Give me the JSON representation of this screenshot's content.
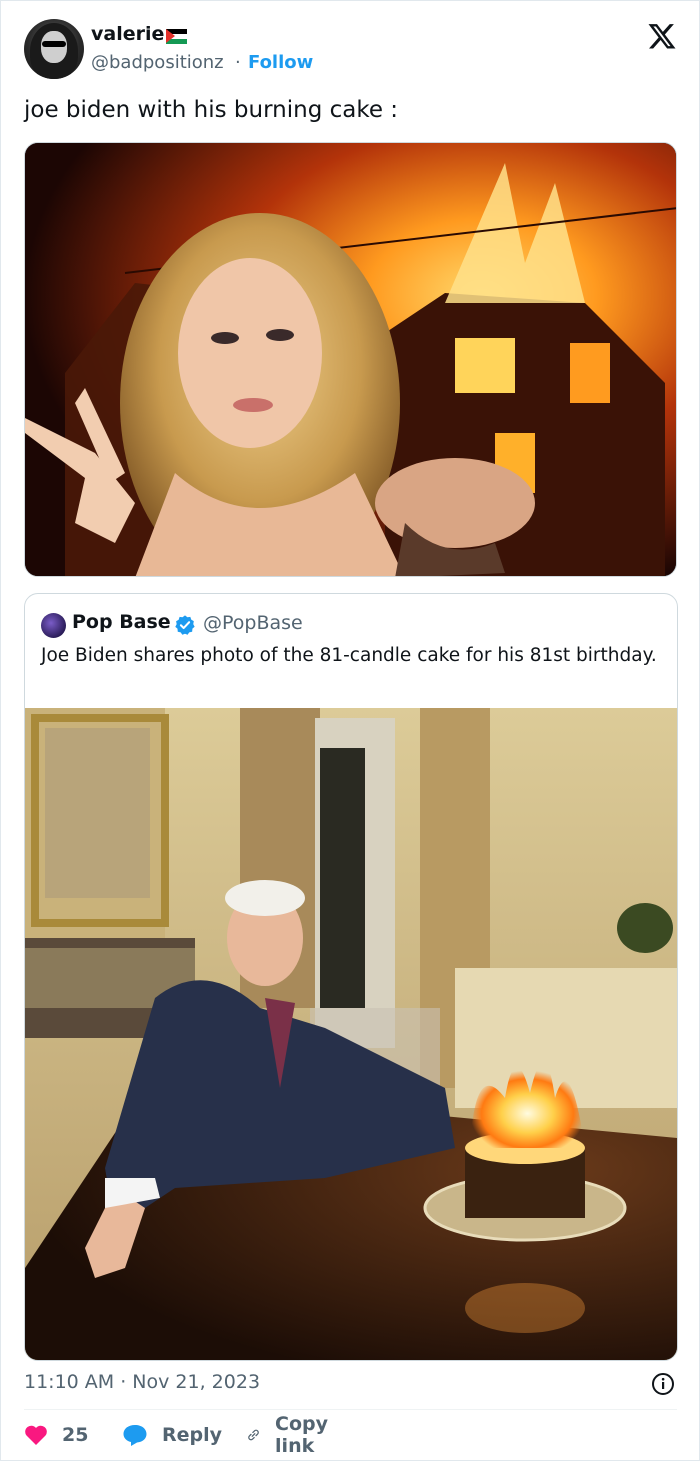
{
  "user": {
    "display_name": "valerie",
    "handle": "@badpositionz",
    "separator": "·",
    "follow_label": "Follow"
  },
  "icons": {
    "flag": "palestine-flag-emoji",
    "logo": "x-logo-icon",
    "verified": "verified-badge-icon",
    "info": "info-icon",
    "like": "heart-icon",
    "reply": "reply-bubble-icon",
    "copy": "link-icon"
  },
  "tweet": {
    "text": "joe biden with his burning cake :",
    "timestamp": "11:10 AM · Nov 21, 2023"
  },
  "quoted": {
    "display_name": "Pop Base",
    "handle": "@PopBase",
    "text": "Joe Biden shares photo of the 81-candle cake for his 81st birthday."
  },
  "actions": {
    "likes": "25",
    "reply_label": "Reply",
    "copy_label": "Copy link"
  },
  "colors": {
    "accent": "#1d9bf0",
    "like": "#f91880",
    "text_secondary": "#536471"
  }
}
